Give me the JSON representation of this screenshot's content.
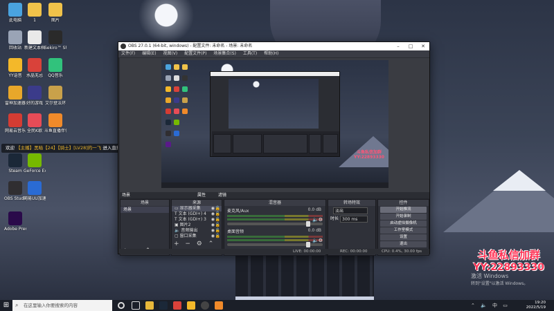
{
  "desktop_icons": [
    {
      "label": "此电脑",
      "name": "this-pc-icon",
      "color": "#4aa3df"
    },
    {
      "label": "1",
      "name": "folder-1-icon",
      "color": "#f0c24a"
    },
    {
      "label": "图片",
      "name": "folder-pictures-icon",
      "color": "#f0c24a"
    },
    {
      "label": "回收站",
      "name": "recycle-bin-icon",
      "color": "#9aa4b6"
    },
    {
      "label": "新建文本档",
      "name": "new-text-file-icon",
      "color": "#e9e9e9"
    },
    {
      "label": "Sekiro™ Shadows...",
      "name": "sekiro-game-icon",
      "color": "#2a2a2a"
    },
    {
      "label": "YY语音",
      "name": "yy-voice-icon",
      "color": "#f3b82a"
    },
    {
      "label": "水晶无忌",
      "name": "app-crystal-icon",
      "color": "#d9423a"
    },
    {
      "label": "QQ音乐",
      "name": "qq-music-icon",
      "color": "#31c27c"
    },
    {
      "label": "雷神加速器",
      "name": "leishen-accelerator-icon",
      "color": "#e8a72a"
    },
    {
      "label": "好的游戏",
      "name": "game-app-icon",
      "color": "#3b3b8a"
    },
    {
      "label": "艾尔登法环",
      "name": "elden-ring-icon",
      "color": "#c9a14a"
    },
    {
      "label": "网易云音乐",
      "name": "netease-music-icon",
      "color": "#d43c33"
    },
    {
      "label": "全民K歌",
      "name": "quanmin-k-icon",
      "color": "#e74c57"
    },
    {
      "label": "斗鱼直播伴侣",
      "name": "douyu-icon",
      "color": "#f08a2a"
    },
    {
      "label": "Steam",
      "name": "steam-icon",
      "color": "#1b2838"
    },
    {
      "label": "GeForce Experience",
      "name": "geforce-icon",
      "color": "#76b900"
    },
    {
      "label": "OBS Studio",
      "name": "obs-studio-icon",
      "color": "#302e31"
    },
    {
      "label": "网易UU加速",
      "name": "uu-accelerator-icon",
      "color": "#2a6bd4"
    },
    {
      "label": "Adobe Premie...",
      "name": "adobe-premiere-icon",
      "color": "#2a0a4a"
    }
  ],
  "danmaku": {
    "prefix": "欢迎",
    "user": "【主播】黑暗【24】【骑士】[LV28]的一飞",
    "suffix": "进入直播间"
  },
  "obs": {
    "title": "OBS 27.0.1 (64-bit, windows) - 配置文件: 未命名 - 场景: 未命名",
    "menu": [
      "文件(F)",
      "编辑(E)",
      "视图(V)",
      "配置文件(P)",
      "场景集合(S)",
      "工具(T)",
      "帮助(H)"
    ],
    "scene_label": "场景",
    "scene_toolbar": [
      "属性",
      "滤镜"
    ],
    "docks": {
      "scenes_title": "场景",
      "sources_title": "来源",
      "mixer_title": "混音器",
      "transitions_title": "转场特效",
      "controls_title": "控件"
    },
    "scenes": [
      "场景"
    ],
    "sources": [
      "显示器采集",
      "文本 (GDI+) 4",
      "文本 (GDI+) 3",
      "图片2",
      "音频输出",
      "窗口采集"
    ],
    "mixer": [
      {
        "name": "麦克风/Aux",
        "db": "0.0 dB"
      },
      {
        "name": "桌面音频",
        "db": "0.0 dB"
      }
    ],
    "transitions": {
      "type_label": "淡出",
      "duration_label": "时长",
      "duration_value": "300 ms"
    },
    "controls": [
      "开始推流",
      "开始录制",
      "启动虚拟摄像机",
      "工作室模式",
      "设置",
      "退出"
    ],
    "status": {
      "live": "LIVE: 00:00:00",
      "rec": "REC: 00:00:00",
      "cpu": "CPU: 0.4%, 30.00 fps"
    },
    "preview_watermark_1": "斗鱼私信加群",
    "preview_watermark_2": "YY:22893330"
  },
  "promo": {
    "line1": "斗鱼私信加群",
    "line2": "YY:22893330"
  },
  "activation": {
    "line1": "激活 Windows",
    "line2": "转到\"设置\"以激活 Windows。"
  },
  "taskbar": {
    "search_placeholder": "在这里输入你要搜索的内容",
    "time": "19:20",
    "date": "2022/5/19"
  }
}
